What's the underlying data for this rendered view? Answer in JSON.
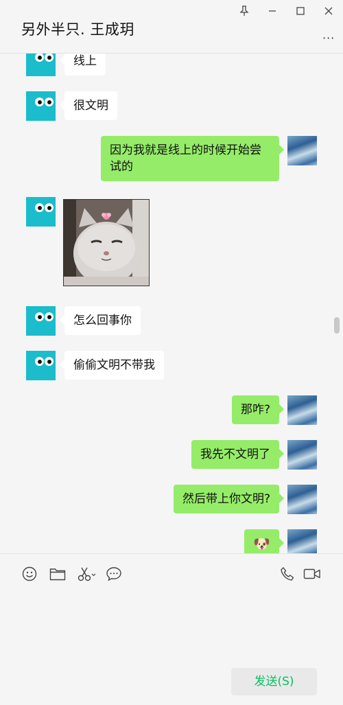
{
  "header": {
    "title": "另外半只. 王成玥",
    "more_label": "···",
    "window_controls": [
      "pin-icon",
      "minimize-icon",
      "maximize-icon",
      "close-icon"
    ]
  },
  "messages": [
    {
      "side": "left",
      "text": "线上"
    },
    {
      "side": "left",
      "text": "很文明"
    },
    {
      "side": "right",
      "text": "因为我就是线上的时候开始尝试的"
    },
    {
      "side": "left",
      "type": "sticker",
      "sticker_subject": "gray cat with pink flower"
    },
    {
      "side": "left",
      "text": "怎么回事你"
    },
    {
      "side": "left",
      "text": "偷偷文明不带我"
    },
    {
      "side": "right",
      "text": "那咋?"
    },
    {
      "side": "right",
      "text": "我先不文明了"
    },
    {
      "side": "right",
      "text": "然后带上你文明?"
    },
    {
      "side": "right",
      "type": "emoji",
      "emoji": "🐶"
    }
  ],
  "toolbar": {
    "icons": [
      "emoji-icon",
      "folder-icon",
      "scissors-icon",
      "chat-bubble-icon",
      "phone-icon",
      "video-icon"
    ],
    "send_label": "发送(S)"
  },
  "colors": {
    "accent_green": "#95ec69",
    "send_text": "#07c160",
    "avatar_teal": "#1bbccb"
  }
}
